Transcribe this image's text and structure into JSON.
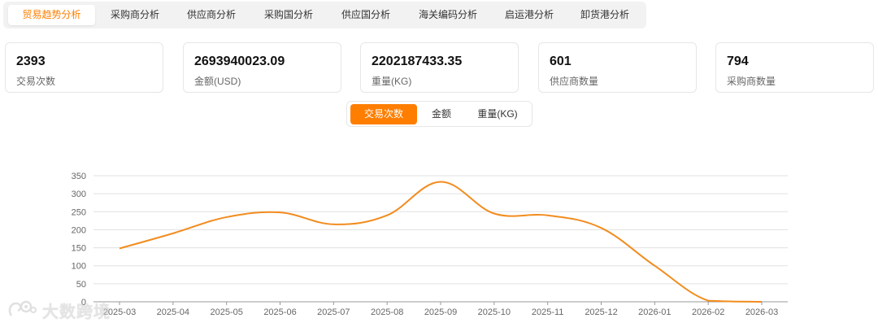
{
  "tabs": [
    {
      "label": "贸易趋势分析",
      "active": true
    },
    {
      "label": "采购商分析",
      "active": false
    },
    {
      "label": "供应商分析",
      "active": false
    },
    {
      "label": "采购国分析",
      "active": false
    },
    {
      "label": "供应国分析",
      "active": false
    },
    {
      "label": "海关编码分析",
      "active": false
    },
    {
      "label": "启运港分析",
      "active": false
    },
    {
      "label": "卸货港分析",
      "active": false
    }
  ],
  "stats": [
    {
      "value": "2393",
      "label": "交易次数"
    },
    {
      "value": "2693940023.09",
      "label": "金额(USD)"
    },
    {
      "value": "2202187433.35",
      "label": "重量(KG)"
    },
    {
      "value": "601",
      "label": "供应商数量"
    },
    {
      "value": "794",
      "label": "采购商数量"
    }
  ],
  "metric_toggle": [
    {
      "label": "交易次数",
      "active": true
    },
    {
      "label": "金额",
      "active": false
    },
    {
      "label": "重量(KG)",
      "active": false
    }
  ],
  "colors": {
    "accent": "#ff7e00",
    "line": "#f28c1e",
    "grid": "#e0e0e0"
  },
  "watermark": {
    "text": "大数跨境",
    "icon": "brand-logo-icon"
  },
  "chart_data": {
    "type": "line",
    "x": [
      "2025-03",
      "2025-04",
      "2025-05",
      "2025-06",
      "2025-07",
      "2025-08",
      "2025-09",
      "2025-10",
      "2025-11",
      "2025-12",
      "2026-01",
      "2026-02",
      "2026-03"
    ],
    "y_ticks": [
      0,
      50,
      100,
      150,
      200,
      250,
      300,
      350
    ],
    "ylim": [
      0,
      350
    ],
    "grid": true,
    "legend": "none",
    "title": "",
    "xlabel": "",
    "ylabel": "",
    "series": [
      {
        "values": [
          148,
          190,
          235,
          248,
          215,
          240,
          333,
          245,
          240,
          205,
          100,
          3,
          0
        ]
      }
    ]
  }
}
